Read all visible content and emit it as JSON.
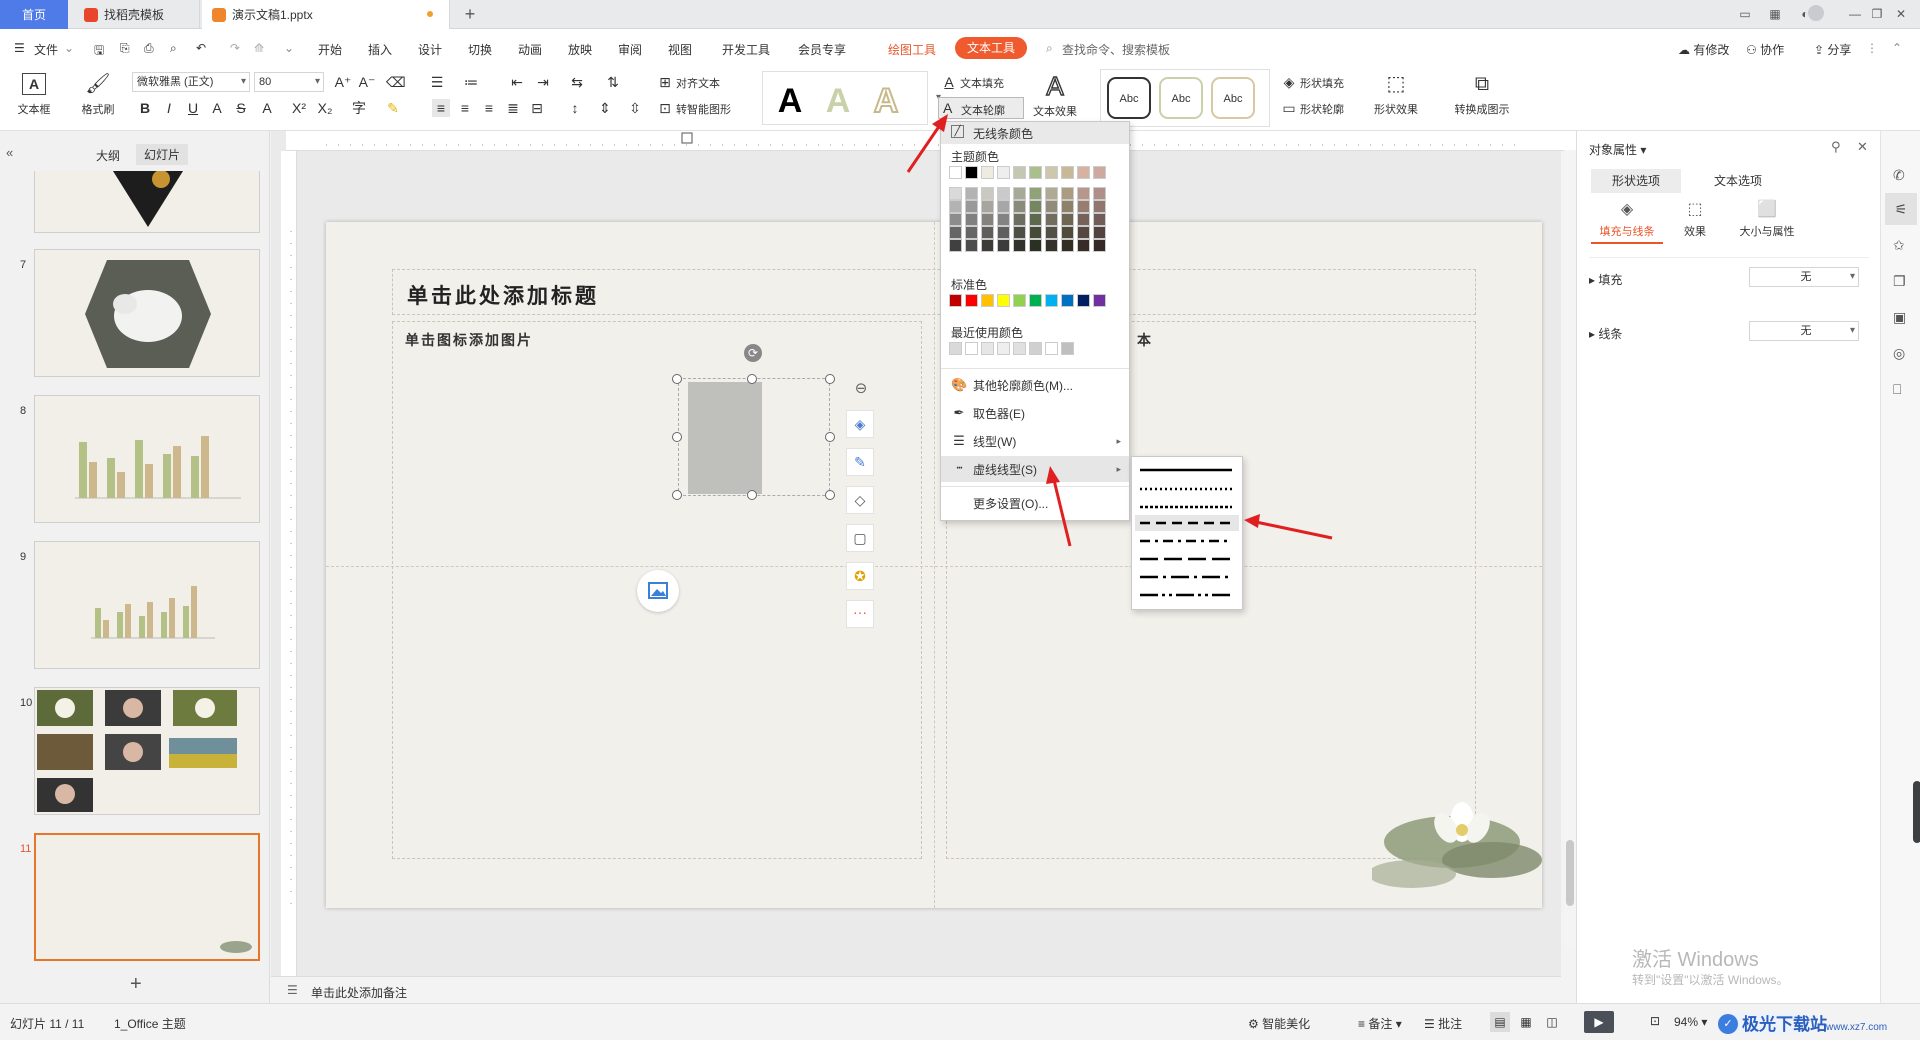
{
  "tabs": {
    "home": "首页",
    "template": "找稻壳模板",
    "document": "演示文稿1.pptx",
    "new_tab": "+"
  },
  "menu": {
    "file": "文件",
    "items": [
      "开始",
      "插入",
      "设计",
      "切换",
      "动画",
      "放映",
      "审阅",
      "视图",
      "开发工具",
      "会员专享"
    ],
    "drawing_tools": "绘图工具",
    "text_tools": "文本工具",
    "search_placeholder": "查找命令、搜索模板",
    "right": {
      "modified": "有修改",
      "collab": "协作",
      "share": "分享"
    }
  },
  "ribbon": {
    "textbox": "文本框",
    "format_painter": "格式刷",
    "font_name": "微软雅黑 (正文)",
    "font_size": "80",
    "align_text": "对齐文本",
    "smart_shape": "转智能图形",
    "text_fill": "文本填充",
    "text_outline": "文本轮廓",
    "text_effect": "文本效果",
    "style_sample": "Abc",
    "shape_fill": "形状填充",
    "shape_outline": "形状轮廓",
    "shape_effect": "形状效果",
    "convert_pic": "转换成图示",
    "big_A": "A"
  },
  "left_pane": {
    "tab_outline": "大纲",
    "tab_slides": "幻灯片",
    "slide_numbers": [
      "7",
      "8",
      "9",
      "10",
      "11"
    ],
    "add_slide": "+"
  },
  "slide": {
    "title_placeholder": "单击此处添加标题",
    "left_placeholder": "单击图标添加图片",
    "right_placeholder_fragment": "本",
    "notes_placeholder": "单击此处添加备注"
  },
  "outline_menu": {
    "no_line": "无线条颜色",
    "theme_colors": "主题颜色",
    "standard_colors": "标准色",
    "recent_colors": "最近使用颜色",
    "more_colors": "其他轮廓颜色(M)...",
    "eyedropper": "取色器(E)",
    "line_type": "线型(W)",
    "dash_type": "虚线线型(S)",
    "more_settings": "更多设置(O)...",
    "standard_palette": [
      "#c00000",
      "#ff0000",
      "#ffc000",
      "#ffff00",
      "#92d050",
      "#00b050",
      "#00b0f0",
      "#0070c0",
      "#002060",
      "#7030a0"
    ],
    "theme_top": [
      "#ffffff",
      "#000000",
      "#eeece1",
      "#eeeeee",
      "#c3c8b0",
      "#a9bf8c",
      "#cfc7ad",
      "#c9b898",
      "#d7b2a3",
      "#cfa8a0"
    ],
    "recent": [
      "#d9d9d9",
      "#ffffff",
      "#e7e6e6",
      "#eeeeee",
      "#e0e0e0",
      "#d0d0d0",
      "#ffffff",
      "#bfbfbf"
    ]
  },
  "right_pane": {
    "title": "对象属性",
    "tab_shape": "形状选项",
    "tab_text": "文本选项",
    "sub_fill_line": "填充与线条",
    "sub_effect": "效果",
    "sub_size": "大小与属性",
    "fill_label": "填充",
    "fill_value": "无",
    "line_label": "线条",
    "line_value": "无"
  },
  "status": {
    "slide_info": "幻灯片 11 / 11",
    "theme": "1_Office 主题",
    "smart_beautify": "智能美化",
    "notes": "备注",
    "comments": "批注",
    "zoom": "94%"
  },
  "watermark": {
    "line1": "激活 Windows",
    "line2": "转到\"设置\"以激活 Windows。",
    "site": "极光下载站",
    "url": "www.xz7.com"
  }
}
